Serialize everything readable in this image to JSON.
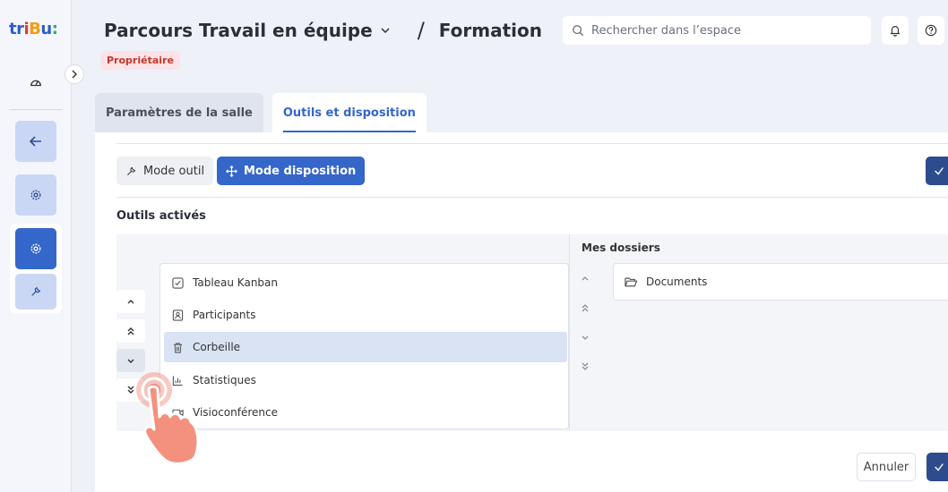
{
  "logo": {
    "p1": "tr",
    "p2": "i",
    "p3": "B",
    "p4": "u",
    "p5": ":"
  },
  "header": {
    "space_title": "Parcours Travail en équipe",
    "separator": "/",
    "page_title": "Formation",
    "role_badge": "Propriétaire",
    "search_placeholder": "Rechercher dans l’espace"
  },
  "tabs": [
    {
      "label": "Paramètres de la salle",
      "active": false
    },
    {
      "label": "Outils et disposition",
      "active": true
    }
  ],
  "toolbar": {
    "mode_outil": "Mode outil",
    "mode_disposition": "Mode disposition"
  },
  "section": {
    "title": "Outils activés"
  },
  "tools": [
    {
      "label": "Tableau Kanban",
      "icon": "checkbox-icon",
      "selected": false
    },
    {
      "label": "Participants",
      "icon": "contact-card-icon",
      "selected": false
    },
    {
      "label": "Corbeille",
      "icon": "trash-icon",
      "selected": true
    },
    {
      "label": "Statistiques",
      "icon": "bar-chart-icon",
      "selected": false
    },
    {
      "label": "Visioconférence",
      "icon": "video-icon",
      "selected": false
    }
  ],
  "folders": {
    "header": "Mes dossiers",
    "items": [
      {
        "label": "Documents",
        "icon": "folder-open-icon"
      }
    ]
  },
  "footer": {
    "cancel_label": "Annuler"
  },
  "colors": {
    "primary": "#3566c9",
    "dark_primary": "#2d4c8d",
    "badge_bg": "#fde3e8",
    "badge_text": "#c0392b",
    "selected_row": "#d9e3f4"
  }
}
